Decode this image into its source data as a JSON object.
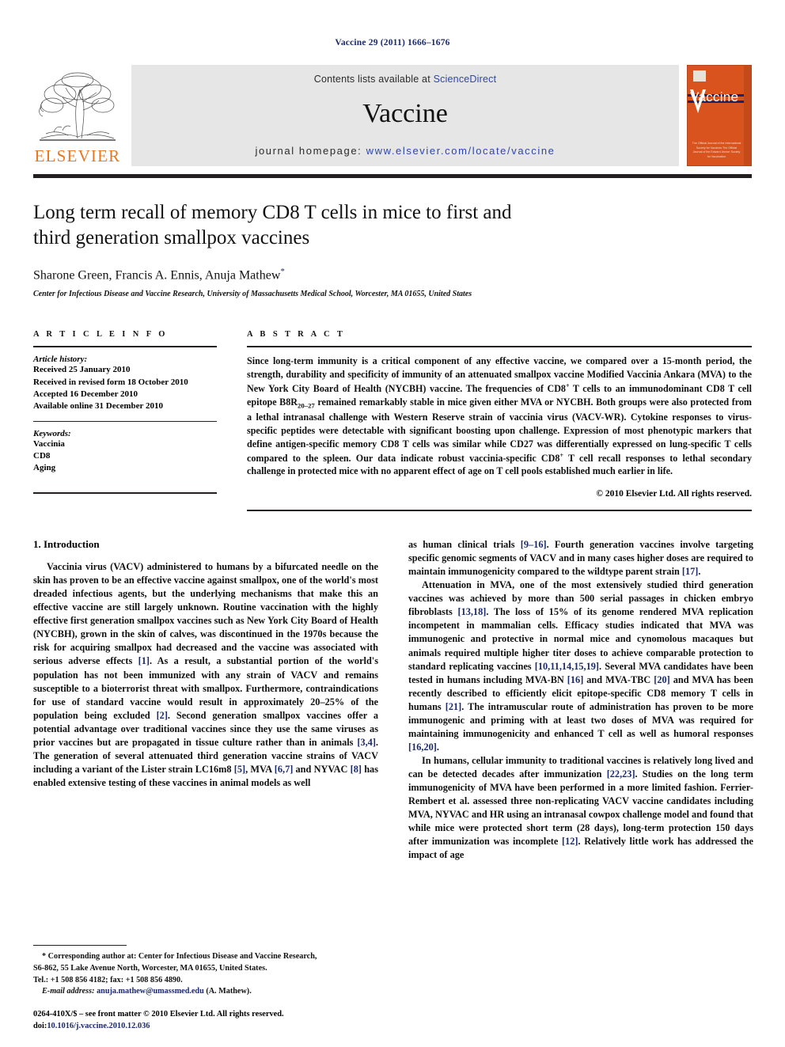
{
  "running_head": "Vaccine 29 (2011) 1666–1676",
  "masthead": {
    "elsevier_wordmark": "ELSEVIER",
    "contents_prefix": "Contents lists available at",
    "sciencedirect": "ScienceDirect",
    "journal_title": "Vaccine",
    "homepage_label": "journal homepage:",
    "homepage_url": "www.elsevier.com/locate/vaccine",
    "cover_title": "Vaccine",
    "cover_footer": "The Official Journal of the International Society for Vaccines\nThe Official Journal of the Edward Jenner Society for Vaccination",
    "accent_orange": "#e87722",
    "link_blue": "#2f46a8",
    "cover_orange": "#d9531e",
    "cover_stripe_blue": "#16256b"
  },
  "article": {
    "title": "Long term recall of memory CD8 T cells in mice to first and third generation smallpox vaccines",
    "authors": "Sharone Green, Francis A. Ennis, Anuja Mathew",
    "corresponding_marker": "*",
    "affiliation": "Center for Infectious Disease and Vaccine Research, University of Massachusetts Medical School, Worcester, MA 01655, United States"
  },
  "article_info": {
    "label": "A R T I C L E   I N F O",
    "history_heading": "Article history:",
    "history": [
      "Received 25 January 2010",
      "Received in revised form 18 October 2010",
      "Accepted 16 December 2010",
      "Available online 31 December 2010"
    ],
    "keywords_heading": "Keywords:",
    "keywords": [
      "Vaccinia",
      "CD8",
      "Aging"
    ]
  },
  "abstract": {
    "label": "A B S T R A C T",
    "part1": "Since long-term immunity is a critical component of any effective vaccine, we compared over a 15-month period, the strength, durability and specificity of immunity of an attenuated smallpox vaccine Modified Vaccinia Ankara (MVA) to the New York City Board of Health (NYCBH) vaccine. The frequencies of CD8",
    "sup1": "+",
    "part2": " T cells to an immunodominant CD8 T cell epitope B8R",
    "sub1": "20–27",
    "part3": " remained remarkably stable in mice given either MVA or NYCBH. Both groups were also protected from a lethal intranasal challenge with Western Reserve strain of vaccinia virus (VACV-WR). Cytokine responses to virus-specific peptides were detectable with significant boosting upon challenge. Expression of most phenotypic markers that define antigen-specific memory CD8 T cells was similar while CD27 was differentially expressed on lung-specific T cells compared to the spleen. Our data indicate robust vaccinia-specific CD8",
    "sup2": "+",
    "part4": " T cell recall responses to lethal secondary challenge in protected mice with no apparent effect of age on T cell pools established much earlier in life.",
    "copyright": "© 2010 Elsevier Ltd. All rights reserved."
  },
  "body": {
    "section_heading": "1.  Introduction",
    "left_p1_a": "Vaccinia virus (VACV) administered to humans by a bifurcated needle on the skin has proven to be an effective vaccine against smallpox, one of the world's most dreaded infectious agents, but the underlying mechanisms that make this an effective vaccine are still largely unknown. Routine vaccination with the highly effective first generation smallpox vaccines such as New York City Board of Health (NYCBH), grown in the skin of calves, was discontinued in the 1970s because the risk for acquiring smallpox had decreased and the vaccine was associated with serious adverse effects ",
    "ref_1": "[1]",
    "left_p1_b": ". As a result, a substantial portion of the world's population has not been immunized with any strain of VACV and remains susceptible to a bioterrorist threat with smallpox. Furthermore, contraindications for use of standard vaccine would result in approximately 20–25% of the population being excluded ",
    "ref_2": "[2]",
    "left_p1_c": ". Second generation smallpox vaccines offer a potential advantage over traditional vaccines since they use the same viruses as prior vaccines but are propagated in tissue culture rather than in animals ",
    "ref_34": "[3,4]",
    "left_p1_d": ". The generation of several attenuated third generation vaccine strains of VACV including a variant of the Lister strain LC16m8 ",
    "ref_5": "[5]",
    "left_p1_e": ", MVA ",
    "ref_67": "[6,7]",
    "left_p1_f": " and NYVAC ",
    "ref_8": "[8]",
    "left_p1_g": " has enabled extensive testing of these vaccines in animal models as well",
    "right_p1_a": "as human clinical trials ",
    "ref_916": "[9–16]",
    "right_p1_b": ". Fourth generation vaccines involve targeting specific genomic segments of VACV and in many cases higher doses are required to maintain immunogenicity compared to the wildtype parent strain ",
    "ref_17": "[17]",
    "right_p1_c": ".",
    "right_p2_a": "Attenuation in MVA, one of the most extensively studied third generation vaccines was achieved by more than 500 serial passages in chicken embryo fibroblasts ",
    "ref_1318": "[13,18]",
    "right_p2_b": ". The loss of 15% of its genome rendered MVA replication incompetent in mammalian cells. Efficacy studies indicated that MVA was immunogenic and protective in normal mice and cynomolous macaques but animals required multiple higher titer doses to achieve comparable protection to standard replicating vaccines ",
    "ref_multi": "[10,11,14,15,19]",
    "right_p2_c": ". Several MVA candidates have been tested in humans including MVA-BN ",
    "ref_16": "[16]",
    "right_p2_d": " and MVA-TBC ",
    "ref_20": "[20]",
    "right_p2_e": " and MVA has been recently described to efficiently elicit epitope-specific CD8 memory T cells in humans ",
    "ref_21": "[21]",
    "right_p2_f": ". The intramuscular route of administration has proven to be more immunogenic and priming with at least two doses of MVA was required for maintaining immunogenicity and enhanced T cell as well as humoral responses ",
    "ref_1620": "[16,20]",
    "right_p2_g": ".",
    "right_p3_a": "In humans, cellular immunity to traditional vaccines is relatively long lived and can be detected decades after immunization ",
    "ref_2223": "[22,23]",
    "right_p3_b": ". Studies on the long term immunogenicity of MVA have been performed in a more limited fashion. Ferrier-Rembert et al. assessed three non-replicating VACV vaccine candidates including MVA, NYVAC and HR using an intranasal cowpox challenge model and found that while mice were protected short term (28 days), long-term protection 150 days after immunization was incomplete ",
    "ref_12": "[12]",
    "right_p3_c": ". Relatively little work has addressed the impact of age"
  },
  "footnote": {
    "line1": "* Corresponding author at: Center for Infectious Disease and Vaccine Research,",
    "line2": "S6-862, 55 Lake Avenue North, Worcester, MA 01655, United States.",
    "line3": "Tel.: +1 508 856 4182; fax: +1 508 856 4890.",
    "email_label": "E-mail address:",
    "email": "anuja.mathew@umassmed.edu",
    "email_suffix": "(A. Mathew)."
  },
  "imprint": {
    "line1": "0264-410X/$ – see front matter © 2010 Elsevier Ltd. All rights reserved.",
    "doi_prefix": "doi:",
    "doi": "10.1016/j.vaccine.2010.12.036"
  }
}
